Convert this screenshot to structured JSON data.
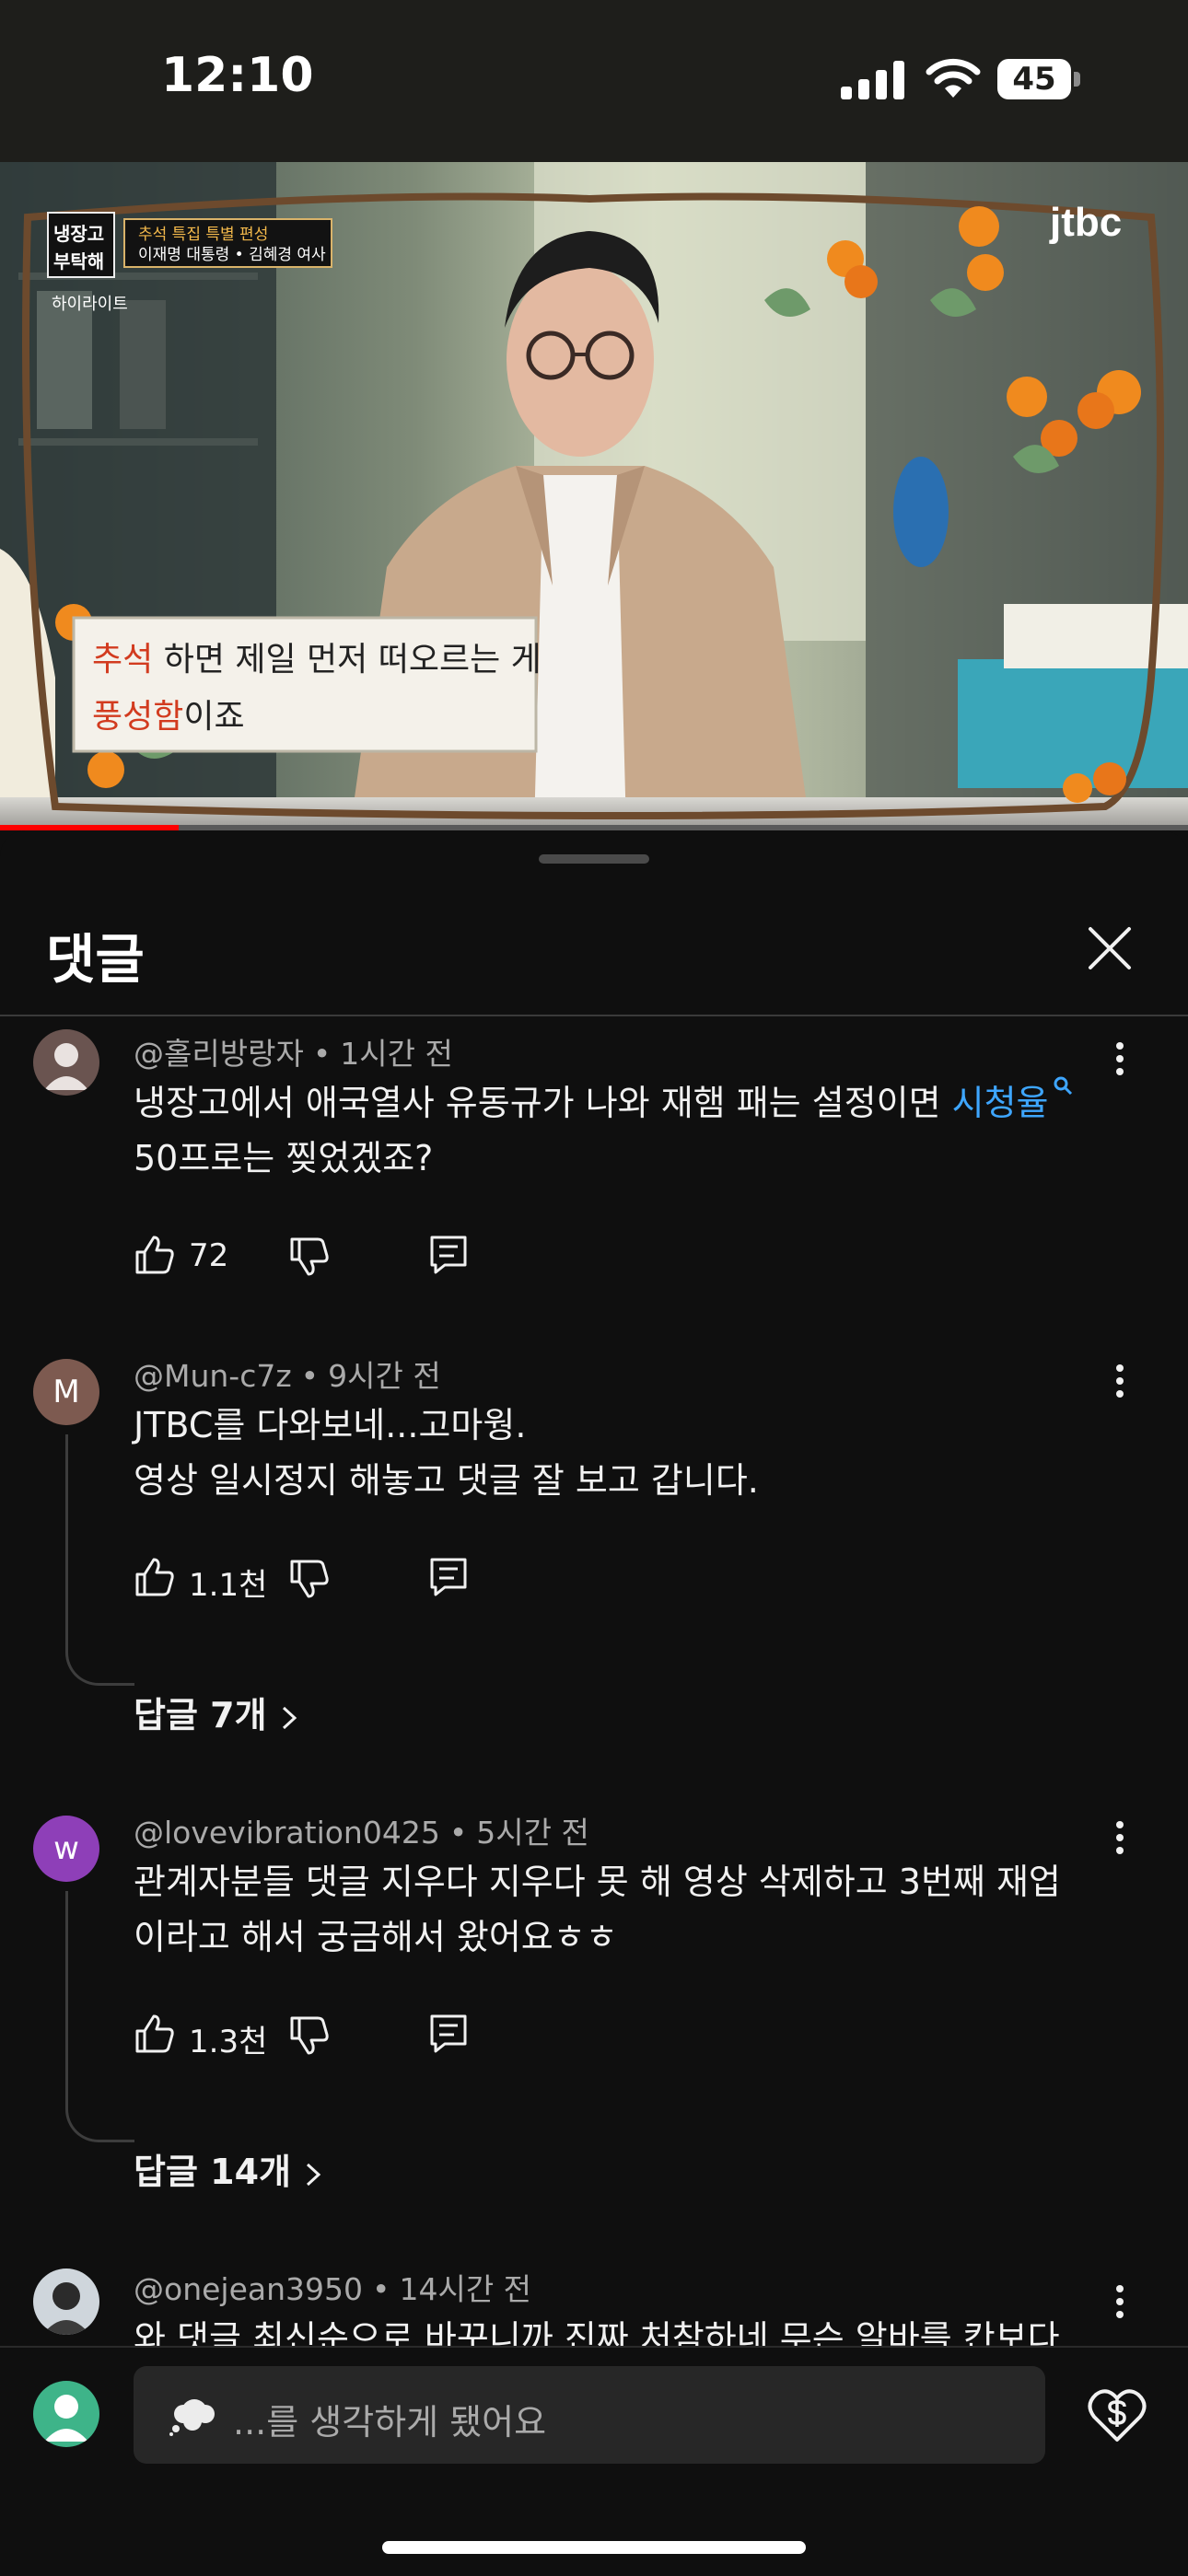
{
  "status": {
    "time": "12:10",
    "battery": "45"
  },
  "video": {
    "show_logo": "냉장고를 부탁해",
    "show_logo_line1": "냉장고",
    "show_logo_line2": "부탁해",
    "show_badge": "하이라이트",
    "banner_line1": "추석 특집 특별 편성",
    "banner_line2": "이재명 대통령 • 김혜경 여사",
    "channel_logo": "jtbc",
    "caption_line1_accent": "추석",
    "caption_line1_rest": " 하면 제일 먼저 떠오르는 게",
    "caption_line2_accent": "풍성함",
    "caption_line2_rest": "이죠",
    "progress": 0.15
  },
  "sheet": {
    "title": "댓글"
  },
  "comments": [
    {
      "author": "@홀리방랑자",
      "time": "1시간 전",
      "text_before_link": "냉장고에서 애국열사 유동규가 나와 재햄 패는 설정이면 ",
      "link": "시청율",
      "text_after_link": "50프로는 찢었겠죠?",
      "likes": "72"
    },
    {
      "author": "@Mun-c7z",
      "avatar_letter": "M",
      "time": "9시간 전",
      "text_line1": "JTBC를 다와보네...고마웡.",
      "text_line2": "영상 일시정지 해놓고 댓글 잘 보고 갑니다.",
      "likes": "1.1천",
      "replies": "답글 7개"
    },
    {
      "author": "@lovevibration0425",
      "avatar_letter": "w",
      "time": "5시간 전",
      "text_line1": "관계자분들 댓글 지우다 지우다 못 해 영상 삭제하고 3번째 재업",
      "text_line2": "이라고 해서 궁금해서 왔어요ㅎㅎ",
      "likes": "1.3천",
      "replies": "답글 14개"
    },
    {
      "author": "@onejean3950",
      "time": "14시간 전",
      "text_line1": "와 댓글 최신순으로 바꾸니까 진짜 처참하네 무슨 알바를 칸보다"
    }
  ],
  "input": {
    "placeholder": "...를 생각하게 됐어요"
  },
  "colors": {
    "link": "#3ea6ff",
    "background": "#0f0f0f",
    "progress": "#ff0000"
  }
}
